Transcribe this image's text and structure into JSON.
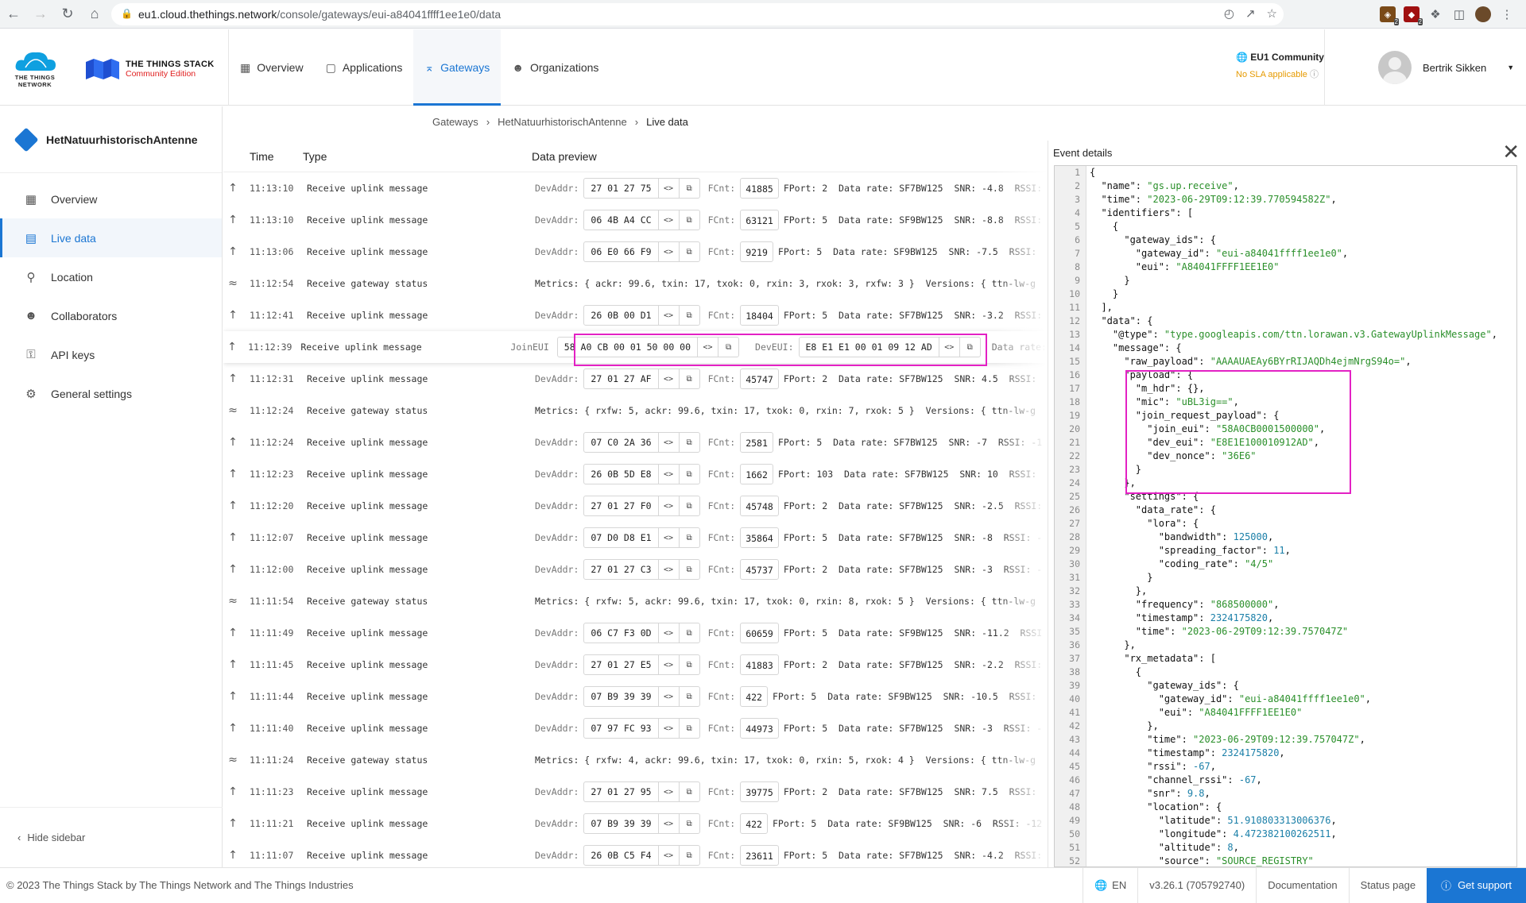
{
  "browser": {
    "url_host": "eu1.cloud.thethings.network",
    "url_path": "/console/gateways/eui-a84041ffff1ee1e0/data",
    "ext_badges": [
      "2",
      "2"
    ]
  },
  "header": {
    "ttn_logo_text_1": "THE THINGS",
    "ttn_logo_text_2": "NETWORK",
    "stack_title": "THE THINGS STACK",
    "stack_edition": "Community Edition",
    "nav": [
      {
        "label": "Overview",
        "icon": "grid-icon"
      },
      {
        "label": "Applications",
        "icon": "window-icon"
      },
      {
        "label": "Gateways",
        "icon": "gateway-icon"
      },
      {
        "label": "Organizations",
        "icon": "people-icon"
      }
    ],
    "cluster_name": "EU1 Community",
    "cluster_sla": "No SLA applicable",
    "user_name": "Bertrik Sikken"
  },
  "sidebar": {
    "gateway_name": "HetNatuurhistorischAntenne",
    "items": [
      {
        "label": "Overview",
        "icon": "grid-icon"
      },
      {
        "label": "Live data",
        "icon": "list-icon"
      },
      {
        "label": "Location",
        "icon": "pin-icon"
      },
      {
        "label": "Collaborators",
        "icon": "people-icon"
      },
      {
        "label": "API keys",
        "icon": "key-icon"
      },
      {
        "label": "General settings",
        "icon": "gear-icon"
      }
    ],
    "hide_label": "Hide sidebar"
  },
  "breadcrumb": [
    "Gateways",
    "HetNatuurhistorischAntenne",
    "Live data"
  ],
  "table": {
    "headers": {
      "time": "Time",
      "type": "Type",
      "preview": "Data preview"
    },
    "rows": [
      {
        "kind": "up",
        "time": "11:13:10",
        "type": "Receive uplink message",
        "devaddr": "27 01 27 75",
        "fcnt": "41885",
        "rest": "FPort: 2  Data rate: SF7BW125  SNR: -4.8  RSSI:"
      },
      {
        "kind": "up",
        "time": "11:13:10",
        "type": "Receive uplink message",
        "devaddr": "06 4B A4 CC",
        "fcnt": "63121",
        "rest": "FPort: 5  Data rate: SF9BW125  SNR: -8.8  RSSI:"
      },
      {
        "kind": "up",
        "time": "11:13:06",
        "type": "Receive uplink message",
        "devaddr": "06 E0 66 F9",
        "fcnt": "9219",
        "rest": "FPort: 5  Data rate: SF9BW125  SNR: -7.5  RSSI:"
      },
      {
        "kind": "status",
        "time": "11:12:54",
        "type": "Receive gateway status",
        "text": "Metrics: { ackr: 99.6, txin: 17, txok: 0, rxin: 3, rxok: 3, rxfw: 3 }  Versions: { ttn-lw-g"
      },
      {
        "kind": "up",
        "time": "11:12:41",
        "type": "Receive uplink message",
        "devaddr": "26 0B 00 D1",
        "fcnt": "18404",
        "rest": "FPort: 5  Data rate: SF7BW125  SNR: -3.2  RSSI:"
      },
      {
        "kind": "join",
        "time": "11:12:39",
        "type": "Receive uplink message",
        "joineui": "58 A0 CB 00 01 50 00 00",
        "deveui": "E8 E1 E1 00 01 09 12 AD",
        "rest": "Data rate:"
      },
      {
        "kind": "up",
        "time": "11:12:31",
        "type": "Receive uplink message",
        "devaddr": "27 01 27 AF",
        "fcnt": "45747",
        "rest": "FPort: 2  Data rate: SF7BW125  SNR: 4.5  RSSI:"
      },
      {
        "kind": "status",
        "time": "11:12:24",
        "type": "Receive gateway status",
        "text": "Metrics: { rxfw: 5, ackr: 99.6, txin: 17, txok: 0, rxin: 7, rxok: 5 }  Versions: { ttn-lw-g"
      },
      {
        "kind": "up",
        "time": "11:12:24",
        "type": "Receive uplink message",
        "devaddr": "07 C0 2A 36",
        "fcnt": "2581",
        "rest": "FPort: 5  Data rate: SF7BW125  SNR: -7  RSSI: -1"
      },
      {
        "kind": "up",
        "time": "11:12:23",
        "type": "Receive uplink message",
        "devaddr": "26 0B 5D E8",
        "fcnt": "1662",
        "rest": "FPort: 103  Data rate: SF7BW125  SNR: 10  RSSI:"
      },
      {
        "kind": "up",
        "time": "11:12:20",
        "type": "Receive uplink message",
        "devaddr": "27 01 27 F0",
        "fcnt": "45748",
        "rest": "FPort: 2  Data rate: SF7BW125  SNR: -2.5  RSSI:"
      },
      {
        "kind": "up",
        "time": "11:12:07",
        "type": "Receive uplink message",
        "devaddr": "07 D0 D8 E1",
        "fcnt": "35864",
        "rest": "FPort: 5  Data rate: SF7BW125  SNR: -8  RSSI: -"
      },
      {
        "kind": "up",
        "time": "11:12:00",
        "type": "Receive uplink message",
        "devaddr": "27 01 27 C3",
        "fcnt": "45737",
        "rest": "FPort: 2  Data rate: SF7BW125  SNR: -3  RSSI: -"
      },
      {
        "kind": "status",
        "time": "11:11:54",
        "type": "Receive gateway status",
        "text": "Metrics: { rxfw: 5, ackr: 99.6, txin: 17, txok: 0, rxin: 8, rxok: 5 }  Versions: { ttn-lw-g"
      },
      {
        "kind": "up",
        "time": "11:11:49",
        "type": "Receive uplink message",
        "devaddr": "06 C7 F3 0D",
        "fcnt": "60659",
        "rest": "FPort: 5  Data rate: SF9BW125  SNR: -11.2  RSSI"
      },
      {
        "kind": "up",
        "time": "11:11:45",
        "type": "Receive uplink message",
        "devaddr": "27 01 27 E5",
        "fcnt": "41883",
        "rest": "FPort: 2  Data rate: SF7BW125  SNR: -2.2  RSSI:"
      },
      {
        "kind": "up",
        "time": "11:11:44",
        "type": "Receive uplink message",
        "devaddr": "07 B9 39 39",
        "fcnt": "422",
        "rest": "FPort: 5  Data rate: SF9BW125  SNR: -10.5  RSSI:"
      },
      {
        "kind": "up",
        "time": "11:11:40",
        "type": "Receive uplink message",
        "devaddr": "07 97 FC 93",
        "fcnt": "44973",
        "rest": "FPort: 5  Data rate: SF7BW125  SNR: -3  RSSI: -"
      },
      {
        "kind": "status",
        "time": "11:11:24",
        "type": "Receive gateway status",
        "text": "Metrics: { rxfw: 4, ackr: 99.6, txin: 17, txok: 0, rxin: 5, rxok: 4 }  Versions: { ttn-lw-g"
      },
      {
        "kind": "up",
        "time": "11:11:23",
        "type": "Receive uplink message",
        "devaddr": "27 01 27 95",
        "fcnt": "39775",
        "rest": "FPort: 2  Data rate: SF7BW125  SNR: 7.5  RSSI:"
      },
      {
        "kind": "up",
        "time": "11:11:21",
        "type": "Receive uplink message",
        "devaddr": "07 B9 39 39",
        "fcnt": "422",
        "rest": "FPort: 5  Data rate: SF9BW125  SNR: -6  RSSI: -12"
      },
      {
        "kind": "up",
        "time": "11:11:07",
        "type": "Receive uplink message",
        "devaddr": "26 0B C5 F4",
        "fcnt": "23611",
        "rest": "FPort: 5  Data rate: SF7BW125  SNR: -4.2  RSSI:"
      }
    ],
    "labels": {
      "devaddr": "DevAddr:",
      "fcnt": "FCnt:",
      "joineui": "JoinEUI",
      "deveui": "DevEUI:"
    }
  },
  "details": {
    "title": "Event details",
    "code_lines": [
      "{",
      "  \"name\": \"gs.up.receive\",",
      "  \"time\": \"2023-06-29T09:12:39.770594582Z\",",
      "  \"identifiers\": [",
      "    {",
      "      \"gateway_ids\": {",
      "        \"gateway_id\": \"eui-a84041ffff1ee1e0\",",
      "        \"eui\": \"A84041FFFF1EE1E0\"",
      "      }",
      "    }",
      "  ],",
      "  \"data\": {",
      "    \"@type\": \"type.googleapis.com/ttn.lorawan.v3.GatewayUplinkMessage\",",
      "    \"message\": {",
      "      \"raw_payload\": \"AAAAUAEAy6BYrRIJAQDh4ejmNrgS94o=\",",
      "      \"payload\": {",
      "        \"m_hdr\": {},",
      "        \"mic\": \"uBL3ig==\",",
      "        \"join_request_payload\": {",
      "          \"join_eui\": \"58A0CB0001500000\",",
      "          \"dev_eui\": \"E8E1E100010912AD\",",
      "          \"dev_nonce\": \"36E6\"",
      "        }",
      "      },",
      "      \"settings\": {",
      "        \"data_rate\": {",
      "          \"lora\": {",
      "            \"bandwidth\": 125000,",
      "            \"spreading_factor\": 11,",
      "            \"coding_rate\": \"4/5\"",
      "          }",
      "        },",
      "        \"frequency\": \"868500000\",",
      "        \"timestamp\": 2324175820,",
      "        \"time\": \"2023-06-29T09:12:39.757047Z\"",
      "      },",
      "      \"rx_metadata\": [",
      "        {",
      "          \"gateway_ids\": {",
      "            \"gateway_id\": \"eui-a84041ffff1ee1e0\",",
      "            \"eui\": \"A84041FFFF1EE1E0\"",
      "          },",
      "          \"time\": \"2023-06-29T09:12:39.757047Z\",",
      "          \"timestamp\": 2324175820,",
      "          \"rssi\": -67,",
      "          \"channel_rssi\": -67,",
      "          \"snr\": 9.8,",
      "          \"location\": {",
      "            \"latitude\": 51.910803313006376,",
      "            \"longitude\": 4.472382100262511,",
      "            \"altitude\": 8,",
      "            \"source\": \"SOURCE_REGISTRY\""
    ]
  },
  "footer": {
    "copyright": "© 2023 The Things Stack by The Things Network and The Things Industries",
    "language": "EN",
    "version": "v3.26.1 (705792740)",
    "documentation": "Documentation",
    "status_page": "Status page",
    "support": "Get support"
  },
  "colors": {
    "accent": "#1b76d3",
    "highlight": "#e321c4",
    "sla": "#e69a00"
  }
}
